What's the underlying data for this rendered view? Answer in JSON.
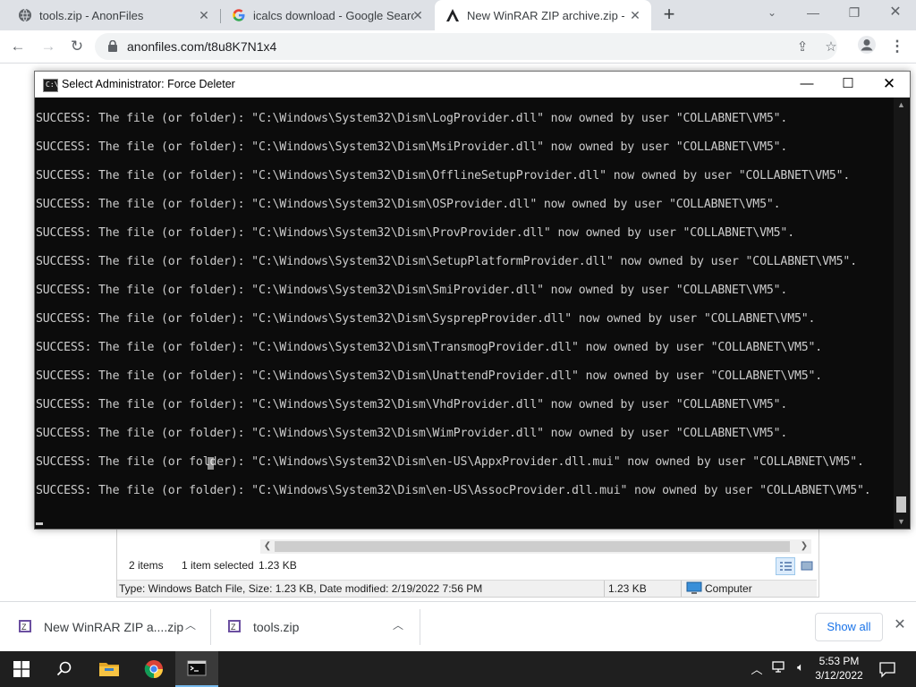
{
  "browser": {
    "tabs": [
      {
        "title": "tools.zip - AnonFiles",
        "favicon": "globe-icon",
        "active": false
      },
      {
        "title": "icalcs download - Google Search",
        "favicon": "google-icon",
        "active": false
      },
      {
        "title": "New WinRAR ZIP archive.zip - Ar",
        "favicon": "anonfiles-icon",
        "active": true
      }
    ],
    "url": "anonfiles.com/t8u8K7N1x4"
  },
  "console": {
    "title": "Select Administrator:  Force Deleter",
    "lines": [
      "SUCCESS: The file (or folder): \"C:\\Windows\\System32\\Dism\\LogProvider.dll\" now owned by user \"COLLABNET\\VM5\".",
      "SUCCESS: The file (or folder): \"C:\\Windows\\System32\\Dism\\MsiProvider.dll\" now owned by user \"COLLABNET\\VM5\".",
      "SUCCESS: The file (or folder): \"C:\\Windows\\System32\\Dism\\OfflineSetupProvider.dll\" now owned by user \"COLLABNET\\VM5\".",
      "SUCCESS: The file (or folder): \"C:\\Windows\\System32\\Dism\\OSProvider.dll\" now owned by user \"COLLABNET\\VM5\".",
      "SUCCESS: The file (or folder): \"C:\\Windows\\System32\\Dism\\ProvProvider.dll\" now owned by user \"COLLABNET\\VM5\".",
      "SUCCESS: The file (or folder): \"C:\\Windows\\System32\\Dism\\SetupPlatformProvider.dll\" now owned by user \"COLLABNET\\VM5\".",
      "SUCCESS: The file (or folder): \"C:\\Windows\\System32\\Dism\\SmiProvider.dll\" now owned by user \"COLLABNET\\VM5\".",
      "SUCCESS: The file (or folder): \"C:\\Windows\\System32\\Dism\\SysprepProvider.dll\" now owned by user \"COLLABNET\\VM5\".",
      "SUCCESS: The file (or folder): \"C:\\Windows\\System32\\Dism\\TransmogProvider.dll\" now owned by user \"COLLABNET\\VM5\".",
      "SUCCESS: The file (or folder): \"C:\\Windows\\System32\\Dism\\UnattendProvider.dll\" now owned by user \"COLLABNET\\VM5\".",
      "SUCCESS: The file (or folder): \"C:\\Windows\\System32\\Dism\\VhdProvider.dll\" now owned by user \"COLLABNET\\VM5\".",
      "SUCCESS: The file (or folder): \"C:\\Windows\\System32\\Dism\\WimProvider.dll\" now owned by user \"COLLABNET\\VM5\".",
      "SUCCESS: The file (or folder): \"C:\\Windows\\System32\\Dism\\en-US\\AppxProvider.dll.mui\" now owned by user \"COLLABNET\\VM5\".",
      "SUCCESS: The file (or folder): \"C:\\Windows\\System32\\Dism\\en-US\\AssocProvider.dll.mui\" now owned by user \"COLLABNET\\VM5\"."
    ]
  },
  "explorer": {
    "item_count": "2 items",
    "selected": "1 item selected",
    "selected_size": "1.23 KB",
    "details": "Type: Windows Batch File, Size: 1.23 KB, Date modified: 2/19/2022 7:56 PM",
    "size": "1.23 KB",
    "location": "Computer"
  },
  "downloads": {
    "items": [
      {
        "name": "New WinRAR ZIP a....zip",
        "icon": "winrar-zip-icon"
      },
      {
        "name": "tools.zip",
        "icon": "winrar-zip-icon"
      }
    ],
    "show_all": "Show all"
  },
  "taskbar": {
    "apps": [
      "start-icon",
      "search-icon",
      "file-explorer-icon",
      "chrome-icon",
      "command-prompt-icon"
    ],
    "time": "5:53 PM",
    "date": "3/12/2022"
  },
  "colors": {
    "console_bg": "#0c0c0c",
    "console_text": "#cccccc",
    "accent": "#1a73e8",
    "taskbar": "#1f1f1f"
  }
}
